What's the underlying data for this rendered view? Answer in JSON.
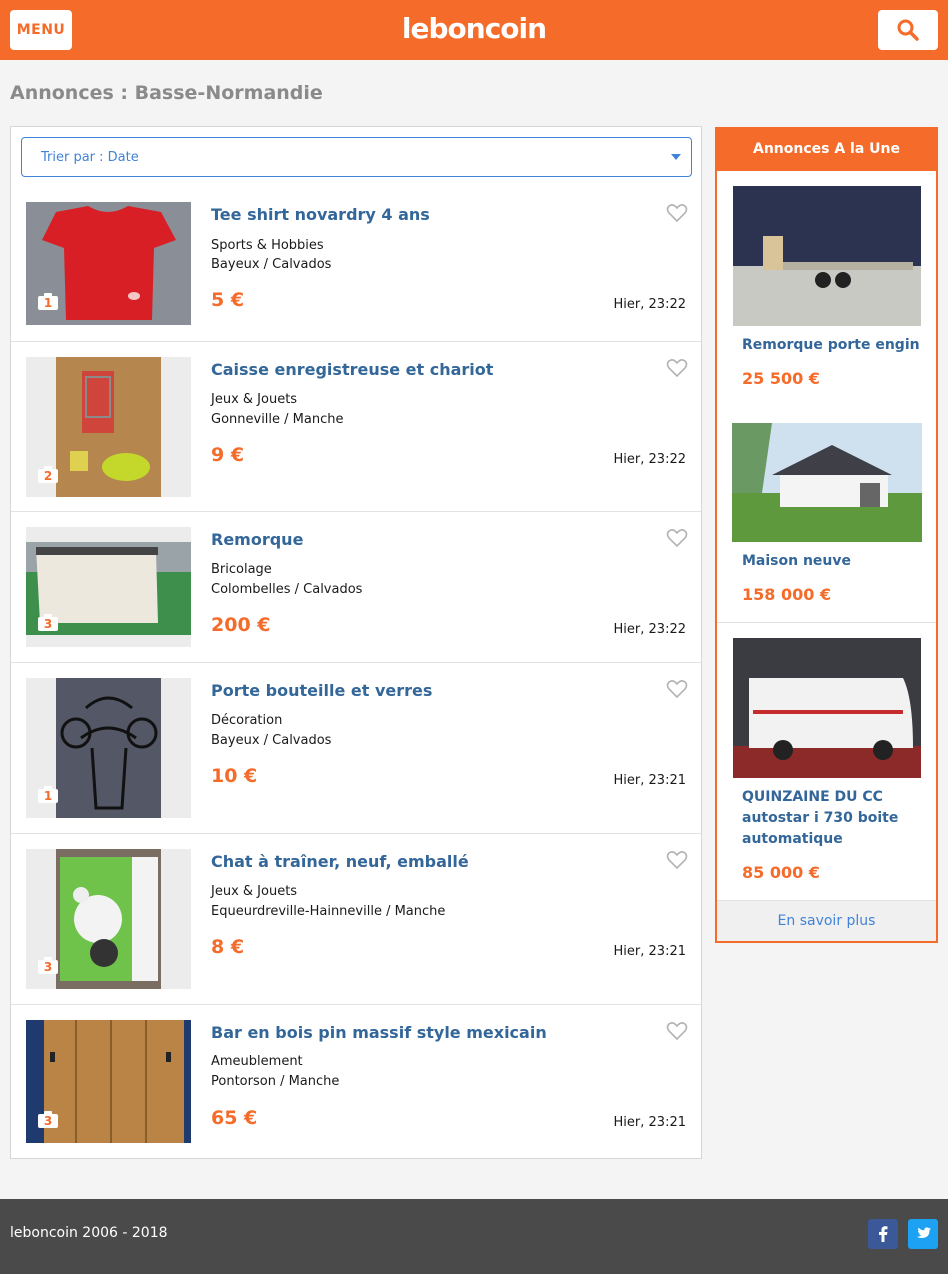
{
  "header": {
    "menu_label": "MENU",
    "logo_text": "leboncoin",
    "brand_color": "#f56b2a",
    "search_icon": "search-icon"
  },
  "page": {
    "title": "Annonces : Basse-Normandie"
  },
  "sort": {
    "label": "Trier par : Date"
  },
  "ads": [
    {
      "title": "Tee shirt novardry 4 ans",
      "category": "Sports & Hobbies",
      "location": "Bayeux / Calvados",
      "price": "5 €",
      "date": "Hier, 23:22",
      "photos": "1"
    },
    {
      "title": "Caisse enregistreuse et chariot",
      "category": "Jeux & Jouets",
      "location": "Gonneville / Manche",
      "price": "9 €",
      "date": "Hier, 23:22",
      "photos": "2"
    },
    {
      "title": "Remorque",
      "category": "Bricolage",
      "location": "Colombelles / Calvados",
      "price": "200 €",
      "date": "Hier, 23:22",
      "photos": "3"
    },
    {
      "title": "Porte bouteille et verres",
      "category": "Décoration",
      "location": "Bayeux / Calvados",
      "price": "10 €",
      "date": "Hier, 23:21",
      "photos": "1"
    },
    {
      "title": "Chat à traîner, neuf, emballé",
      "category": "Jeux & Jouets",
      "location": "Equeurdreville-Hainneville / Manche",
      "price": "8 €",
      "date": "Hier, 23:21",
      "photos": "3"
    },
    {
      "title": "Bar en bois pin massif style mexicain",
      "category": "Ameublement",
      "location": "Pontorson / Manche",
      "price": "65 €",
      "date": "Hier, 23:21",
      "photos": "3"
    }
  ],
  "une": {
    "header": "Annonces A la Une",
    "items": [
      {
        "title": "Remorque porte engin",
        "price": "25 500 €"
      },
      {
        "title": "Maison neuve",
        "price": "158 000 €"
      },
      {
        "title": "QUINZAINE DU CC autostar i 730 boite automatique",
        "price": "85 000 €"
      }
    ],
    "more_label": "En savoir plus"
  },
  "footer": {
    "copyright": "leboncoin 2006 - 2018",
    "facebook_icon": "facebook-icon",
    "twitter_icon": "twitter-icon"
  }
}
